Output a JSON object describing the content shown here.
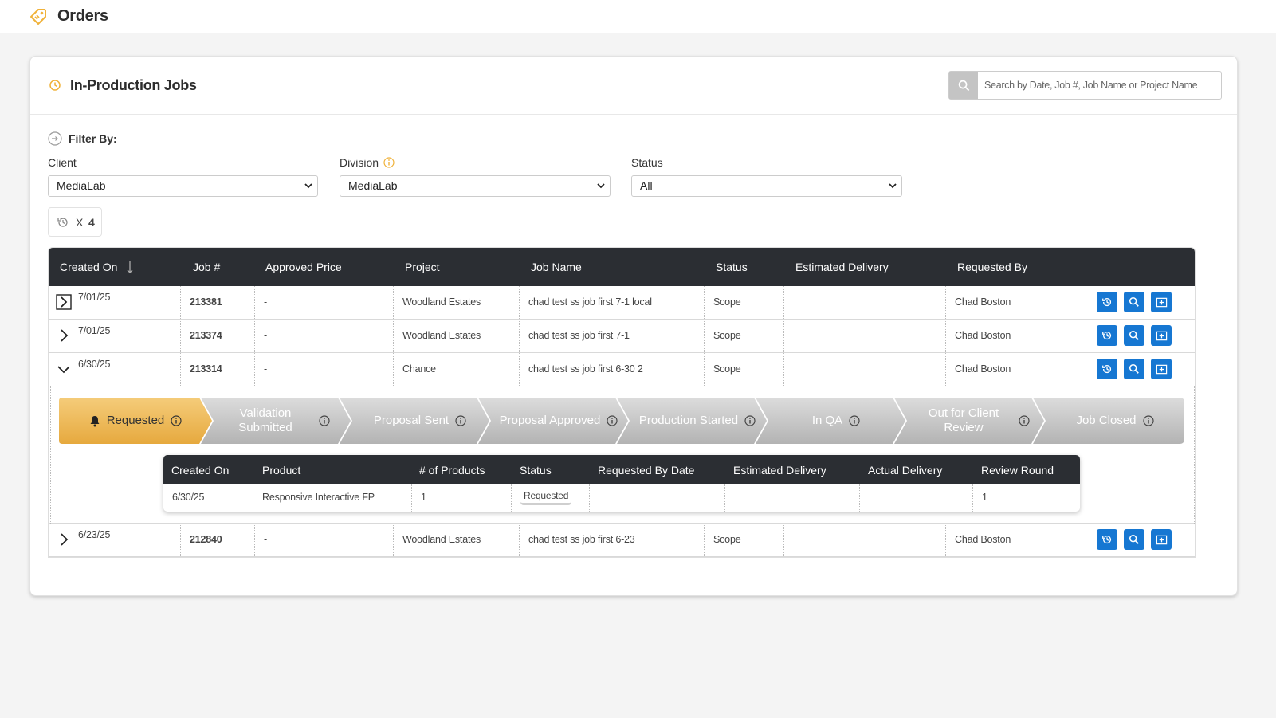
{
  "app": {
    "title": "Orders"
  },
  "card": {
    "title": "In-Production Jobs"
  },
  "search": {
    "placeholder": "Search by Date, Job #, Job Name or Project Name",
    "icon": "search-icon"
  },
  "filters": {
    "title": "Filter By:",
    "client": {
      "label": "Client",
      "value": "MediaLab"
    },
    "division": {
      "label": "Division",
      "value": "MediaLab"
    },
    "status": {
      "label": "Status",
      "value": "All"
    }
  },
  "history_chip": {
    "x": "X",
    "count": "4"
  },
  "colors": {
    "accent": "#f0b23a",
    "primary_button": "#1677d2",
    "header_bg": "#2b2e33"
  },
  "table": {
    "headers": [
      "Created On",
      "Job #",
      "Approved Price",
      "Project",
      "Job Name",
      "Status",
      "Estimated Delivery",
      "Requested By"
    ],
    "rows": [
      {
        "created_on": "7/01/25",
        "job": "213381",
        "price": "-",
        "project": "Woodland Estates",
        "job_name": "chad test ss job first 7-1 local",
        "status": "Scope",
        "estimated": "",
        "requested_by": "Chad Boston",
        "toggle": "chevron-right-boxed"
      },
      {
        "created_on": "7/01/25",
        "job": "213374",
        "price": "-",
        "project": "Woodland Estates",
        "job_name": "chad test ss job first 7-1",
        "status": "Scope",
        "estimated": "",
        "requested_by": "Chad Boston",
        "toggle": "chevron-right"
      },
      {
        "created_on": "6/30/25",
        "job": "213314",
        "price": "-",
        "project": "Chance",
        "job_name": "chad test ss job first 6-30 2",
        "status": "Scope",
        "estimated": "",
        "requested_by": "Chad Boston",
        "toggle": "chevron-down"
      },
      {
        "created_on": "6/23/25",
        "job": "212840",
        "price": "-",
        "project": "Woodland Estates",
        "job_name": "chad test ss job first 6-23",
        "status": "Scope",
        "estimated": "",
        "requested_by": "Chad Boston",
        "toggle": "chevron-right"
      }
    ]
  },
  "progress": {
    "steps": [
      {
        "label": "Requested",
        "active": true
      },
      {
        "label": "Validation Submitted",
        "active": false
      },
      {
        "label": "Proposal Sent",
        "active": false
      },
      {
        "label": "Proposal Approved",
        "active": false
      },
      {
        "label": "Production Started",
        "active": false
      },
      {
        "label": "In QA",
        "active": false
      },
      {
        "label": "Out for Client Review",
        "active": false
      },
      {
        "label": "Job Closed",
        "active": false
      }
    ]
  },
  "subtable": {
    "headers": [
      "Created On",
      "Product",
      "# of Products",
      "Status",
      "Requested By Date",
      "Estimated Delivery",
      "Actual Delivery",
      "Review Round"
    ],
    "row": {
      "created_on": "6/30/25",
      "product": "Responsive Interactive FP",
      "count": "1",
      "status": "Requested",
      "requested_by_date": "",
      "estimated": "",
      "actual": "",
      "review_round": "1"
    }
  }
}
